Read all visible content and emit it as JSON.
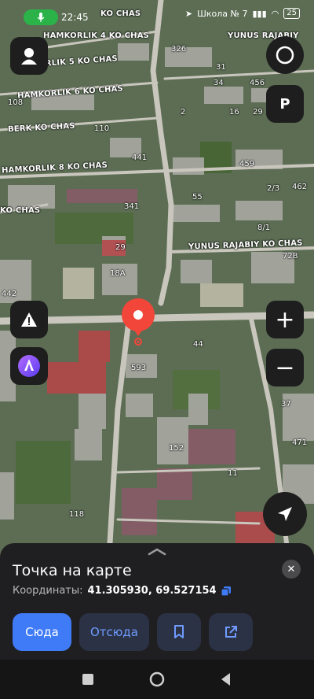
{
  "status_bar": {
    "time": "22:45",
    "network_label": "Школа № 7",
    "battery": "25"
  },
  "map": {
    "streets": [
      {
        "name": "HAMKORLIK 4 KO CHAS"
      },
      {
        "name": "HAMKORLIK 5 KO CHAS"
      },
      {
        "name": "HAMKORLIK 6 KO CHAS"
      },
      {
        "name": "BERK KO CHAS"
      },
      {
        "name": "HAMKORLIK 8 KO CHAS"
      },
      {
        "name": "KO CHAS"
      },
      {
        "name": "YUNUS RAJABIY"
      },
      {
        "name": "YUNUS RAJABIY KO CHAS"
      },
      {
        "name": "KO CHAS"
      }
    ],
    "house_numbers": [
      "326",
      "34",
      "456",
      "31",
      "16",
      "29",
      "108",
      "2",
      "110",
      "441",
      "459",
      "55",
      "2/3",
      "462",
      "341",
      "8/1",
      "29",
      "72B",
      "18A",
      "442",
      "44",
      "593",
      "37",
      "471",
      "152",
      "11",
      "118",
      "7"
    ]
  },
  "controls": {
    "profile": {
      "icon": "profile-icon"
    },
    "layers": {
      "icon": "layers-icon"
    },
    "parking": {
      "label": "P"
    },
    "report": {
      "icon": "warning-icon"
    },
    "assistant": {
      "icon": "alice-icon"
    },
    "zoom_in": {
      "label": "+"
    },
    "zoom_out": {
      "label": "−"
    },
    "locate": {
      "icon": "navigation-arrow-icon"
    }
  },
  "sheet": {
    "title": "Точка на карте",
    "coords_label": "Координаты:",
    "coords_value": "41.305930, 69.527154",
    "buttons": {
      "to_here": "Сюда",
      "from_here": "Отсюда"
    }
  },
  "colors": {
    "accent": "#3f7bf6",
    "pin": "#f2463a",
    "mic": "#2bb34a",
    "sheet_bg": "#1f1f21"
  }
}
